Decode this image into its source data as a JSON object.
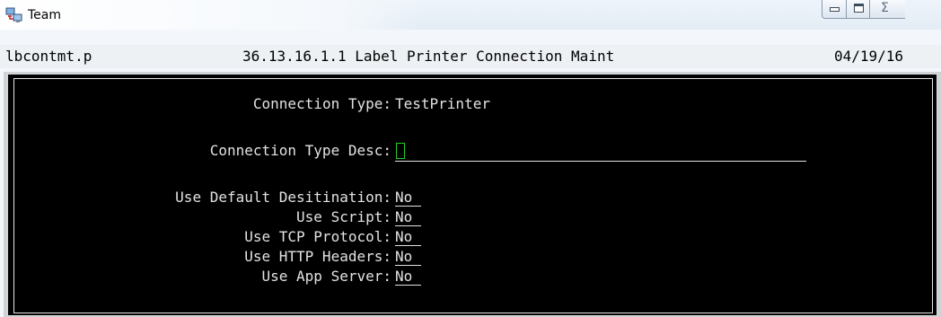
{
  "window": {
    "title": "Team",
    "icons": {
      "app": "computers-network-icon",
      "minimize": "minimize-icon",
      "maximize": "maximize-icon",
      "close": "close-icon"
    },
    "close_glyph": "Σ"
  },
  "status": {
    "program": "lbcontmt.p",
    "menu_title": "36.13.16.1.1 Label Printer Connection Maint",
    "date": "04/19/16"
  },
  "form": {
    "connection_type": {
      "label": "Connection Type:",
      "value": "TestPrinter"
    },
    "connection_type_desc": {
      "label": "Connection Type Desc:",
      "value": ""
    },
    "use_default_destination": {
      "label": "Use Default Desitination:",
      "value": "No "
    },
    "use_script": {
      "label": "Use Script:",
      "value": "No "
    },
    "use_tcp_protocol": {
      "label": "Use TCP Protocol:",
      "value": "No "
    },
    "use_http_headers": {
      "label": "Use HTTP Headers:",
      "value": "No "
    },
    "use_app_server": {
      "label": "Use App Server:",
      "value": "No "
    }
  },
  "colors": {
    "terminal_bg": "#000000",
    "terminal_fg": "#e2e2e2",
    "cursor": "#22d022"
  }
}
